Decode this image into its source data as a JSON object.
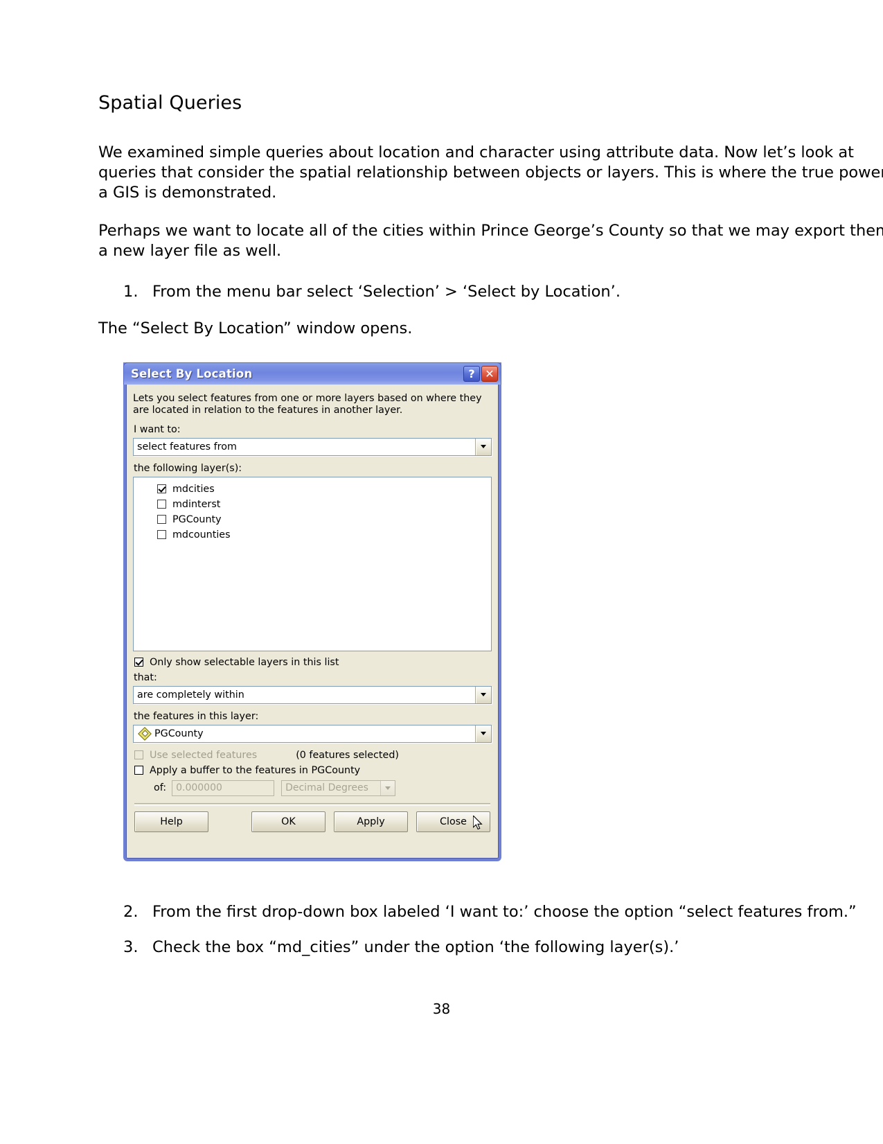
{
  "document": {
    "heading": "Spatial Queries",
    "paragraph_1": "We examined simple queries about location and character using attribute data. Now let’s look at queries that consider the spatial relationship between objects or layers. This is where the true power of a GIS is demonstrated.",
    "paragraph_2": "Perhaps we want to locate all of the cities within Prince George’s County so that we may export them as a new layer file as well.",
    "step_1_num": "1.",
    "step_1_text": "From the menu bar select ‘Selection’ > ‘Select by Location’.",
    "paragraph_3": "The “Select By Location” window opens.",
    "step_2_num": "2.",
    "step_2_text": "From the first drop-down box labeled ‘I want to:’ choose the option “select features from.”",
    "step_3_num": "3.",
    "step_3_text": "Check the box “md_cities” under the option ‘the following layer(s).’",
    "page_number": "38"
  },
  "dialog": {
    "title": "Select By Location",
    "help_button": "?",
    "close_button": "✕",
    "description": "Lets you select features from one or more layers based on where they are located in relation to the features in another layer.",
    "i_want_to_label": "I want to:",
    "i_want_to_value": "select features from",
    "following_layers_label": "the following layer(s):",
    "layers": [
      {
        "name": "mdcities",
        "checked": true
      },
      {
        "name": "mdinterst",
        "checked": false
      },
      {
        "name": "PGCounty",
        "checked": false
      },
      {
        "name": "mdcounties",
        "checked": false
      }
    ],
    "only_selectable_label": "Only show selectable layers in this list",
    "only_selectable_checked": true,
    "that_label": "that:",
    "that_value": "are completely within",
    "features_in_layer_label": "the features in this layer:",
    "features_in_layer_value": "PGCounty",
    "use_selected_features_label": "Use selected features",
    "features_selected_count": "(0 features selected)",
    "apply_buffer_label": "Apply a buffer to the features in PGCounty",
    "of_label": "of:",
    "buffer_value": "0.000000",
    "buffer_units": "Decimal Degrees",
    "buttons": {
      "help": "Help",
      "ok": "OK",
      "apply": "Apply",
      "close": "Close"
    },
    "colors": {
      "titlebar_blue": "#6f85de",
      "client_beige": "#ece9d8",
      "frame_border": "#6f7fd4",
      "symbol_yellow": "#e9e36a"
    }
  }
}
